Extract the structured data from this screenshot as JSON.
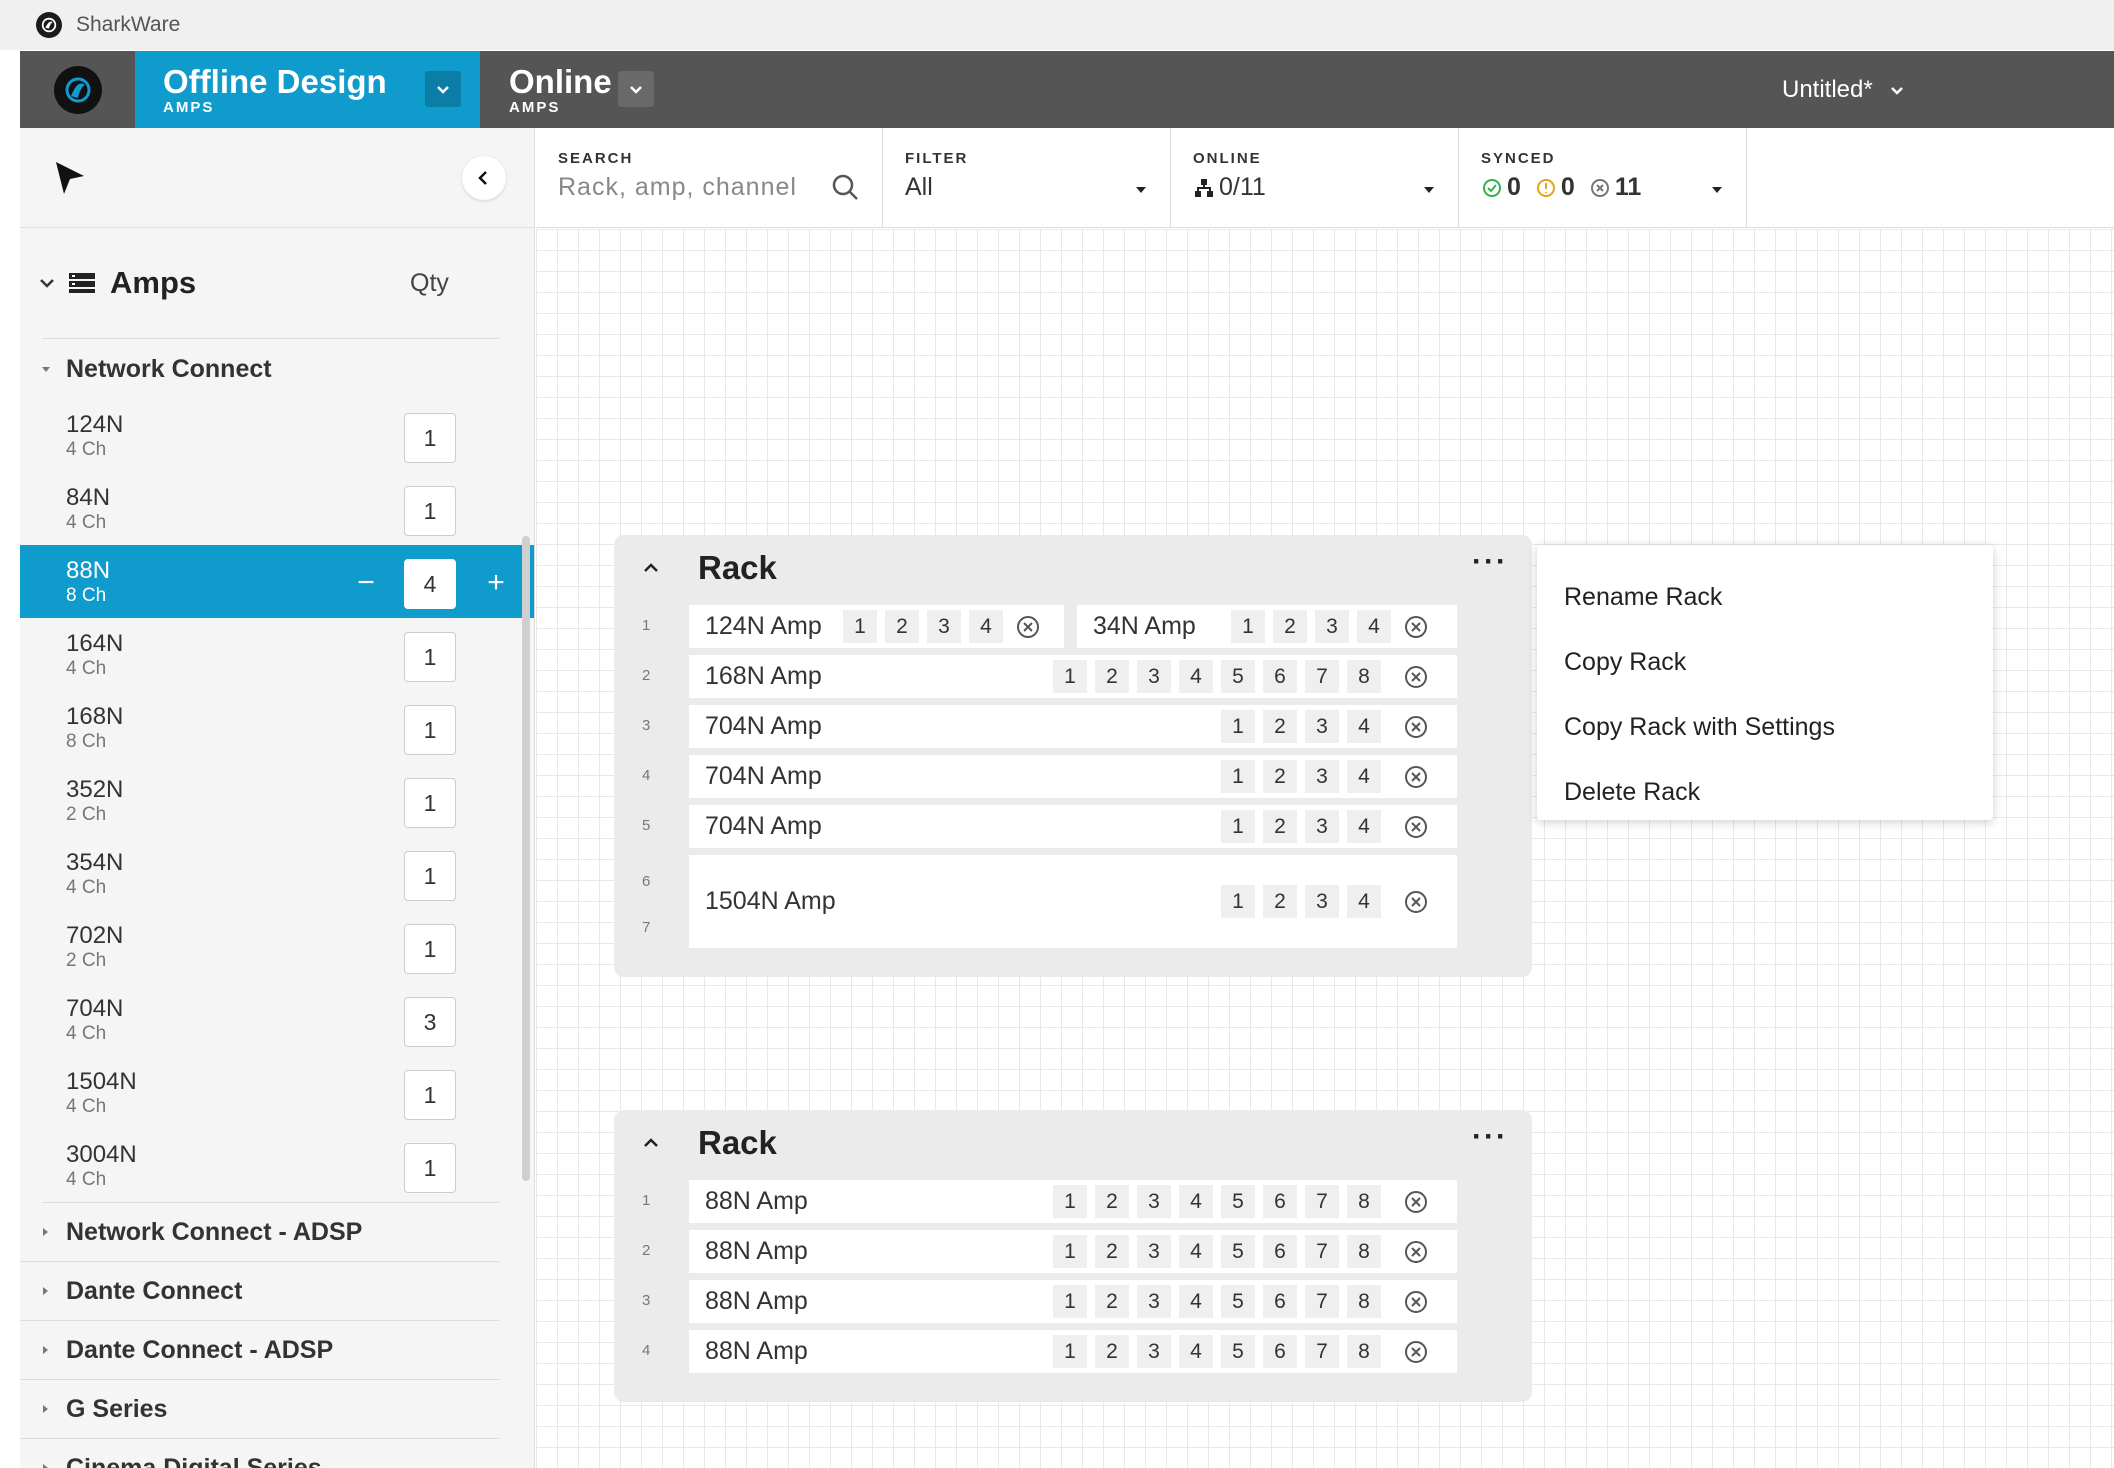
{
  "os": {
    "app_title": "SharkWare"
  },
  "nav": {
    "tabs": [
      {
        "title": "Offline Design",
        "subtitle": "AMPS",
        "active": true
      },
      {
        "title": "Online",
        "subtitle": "AMPS",
        "active": false
      }
    ],
    "file_name": "Untitled*"
  },
  "sidebar": {
    "section_title": "Amps",
    "qty_label": "Qty",
    "open_group": "Network Connect",
    "amps": [
      {
        "name": "124N",
        "channels": "4 Ch",
        "qty": "1"
      },
      {
        "name": "84N",
        "channels": "4 Ch",
        "qty": "1"
      },
      {
        "name": "88N",
        "channels": "8 Ch",
        "qty": "4",
        "selected": true
      },
      {
        "name": "164N",
        "channels": "4 Ch",
        "qty": "1"
      },
      {
        "name": "168N",
        "channels": "8 Ch",
        "qty": "1"
      },
      {
        "name": "352N",
        "channels": "2 Ch",
        "qty": "1"
      },
      {
        "name": "354N",
        "channels": "4 Ch",
        "qty": "1"
      },
      {
        "name": "702N",
        "channels": "2 Ch",
        "qty": "1"
      },
      {
        "name": "704N",
        "channels": "4 Ch",
        "qty": "3"
      },
      {
        "name": "1504N",
        "channels": "4 Ch",
        "qty": "1"
      },
      {
        "name": "3004N",
        "channels": "4 Ch",
        "qty": "1"
      }
    ],
    "minus": "−",
    "plus": "+",
    "collapsed_groups": [
      "Network Connect - ADSP",
      "Dante Connect",
      "Dante Connect - ADSP",
      "G Series",
      "Cinema Digital Series"
    ]
  },
  "toolbar": {
    "search": {
      "label": "SEARCH",
      "placeholder": "Rack, amp, channel"
    },
    "filter": {
      "label": "FILTER",
      "value": "All"
    },
    "online": {
      "label": "ONLINE",
      "value": "0/11"
    },
    "synced": {
      "label": "SYNCED",
      "green": "0",
      "orange": "0",
      "gray": "11"
    }
  },
  "racks": [
    {
      "title": "Rack",
      "more": "···",
      "rows": [
        {
          "slot": "1",
          "amps": [
            {
              "name": "124N Amp",
              "channels": [
                "1",
                "2",
                "3",
                "4"
              ]
            },
            {
              "name": "34N Amp",
              "channels": [
                "1",
                "2",
                "3",
                "4"
              ]
            }
          ]
        },
        {
          "slot": "2",
          "amps": [
            {
              "name": "168N Amp",
              "channels": [
                "1",
                "2",
                "3",
                "4",
                "5",
                "6",
                "7",
                "8"
              ]
            }
          ]
        },
        {
          "slot": "3",
          "amps": [
            {
              "name": "704N Amp",
              "channels": [
                "1",
                "2",
                "3",
                "4"
              ]
            }
          ]
        },
        {
          "slot": "4",
          "amps": [
            {
              "name": "704N Amp",
              "channels": [
                "1",
                "2",
                "3",
                "4"
              ]
            }
          ]
        },
        {
          "slot": "5",
          "amps": [
            {
              "name": "704N Amp",
              "channels": [
                "1",
                "2",
                "3",
                "4"
              ]
            }
          ]
        },
        {
          "slot": "6",
          "slot2": "7",
          "amps": [
            {
              "name": "1504N Amp",
              "channels": [
                "1",
                "2",
                "3",
                "4"
              ]
            }
          ]
        }
      ]
    },
    {
      "title": "Rack",
      "more": "···",
      "rows": [
        {
          "slot": "1",
          "amps": [
            {
              "name": "88N Amp",
              "channels": [
                "1",
                "2",
                "3",
                "4",
                "5",
                "6",
                "7",
                "8"
              ]
            }
          ]
        },
        {
          "slot": "2",
          "amps": [
            {
              "name": "88N Amp",
              "channels": [
                "1",
                "2",
                "3",
                "4",
                "5",
                "6",
                "7",
                "8"
              ]
            }
          ]
        },
        {
          "slot": "3",
          "amps": [
            {
              "name": "88N Amp",
              "channels": [
                "1",
                "2",
                "3",
                "4",
                "5",
                "6",
                "7",
                "8"
              ]
            }
          ]
        },
        {
          "slot": "4",
          "amps": [
            {
              "name": "88N Amp",
              "channels": [
                "1",
                "2",
                "3",
                "4",
                "5",
                "6",
                "7",
                "8"
              ]
            }
          ]
        }
      ]
    }
  ],
  "context_menu": {
    "items": [
      "Rename Rack",
      "Copy Rack",
      "Copy Rack with Settings",
      "Delete Rack"
    ]
  },
  "colors": {
    "accent": "#0f9bcb",
    "topbar": "#555555",
    "synced_green": "#2fb34a",
    "synced_orange": "#e8a317"
  },
  "icons": {
    "logo": "shark-logo-icon",
    "cursor": "pointer-icon",
    "search": "search-icon",
    "sync": "sync-x-icon"
  }
}
